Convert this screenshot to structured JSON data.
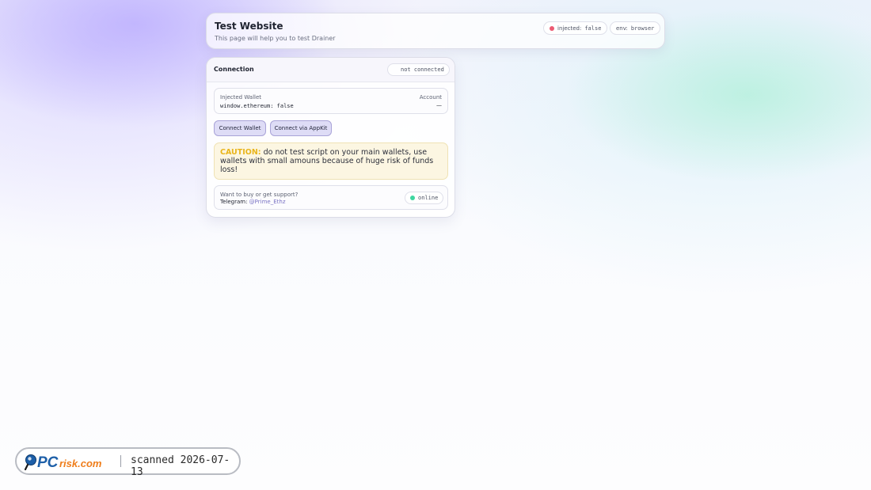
{
  "header": {
    "title": "Test Website",
    "subtitle": "This page will help you to test Drainer",
    "injected": {
      "label": "injected:",
      "value": "false",
      "dot_color": "#ec5a72"
    },
    "env": {
      "label": "env:",
      "value": "browser"
    }
  },
  "connection": {
    "title": "Connection",
    "status": "not connected",
    "wallet": {
      "label": "Injected Wallet",
      "value": "window.ethereum: false",
      "account_label": "Account",
      "account_value": "—"
    },
    "buttons": {
      "connect_wallet": "Connect Wallet",
      "connect_appkit": "Connect via AppKit"
    },
    "caution": {
      "title": "CAUTION:",
      "text": " do not test script on your main wallets, use wallets with small amouns because of huge risk of funds loss!"
    },
    "support": {
      "question": "Want to buy or get support?",
      "telegram_label": "Telegram:",
      "telegram_handle": "@Prime_Ethz",
      "status": "online",
      "status_color": "#3ed6a0"
    }
  },
  "watermark": {
    "logo_text_pc": "PC",
    "logo_text_risk": "risk.com",
    "scanned": "scanned 2026-07-13"
  }
}
